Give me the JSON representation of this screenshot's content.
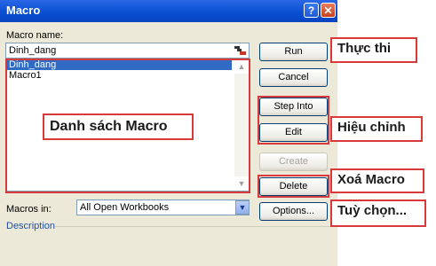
{
  "dialog": {
    "title": "Macro",
    "help_glyph": "?",
    "close_glyph": "✕",
    "macro_name_label": "Macro name:",
    "macro_name_value": "Dinh_dang",
    "macros": [
      "Dinh_dang",
      "Macro1"
    ],
    "selected_index": 0,
    "macros_in_label": "Macros in:",
    "macros_in_value": "All Open Workbooks",
    "description_label": "Description",
    "buttons": {
      "run": "Run",
      "cancel": "Cancel",
      "step_into": "Step Into",
      "edit": "Edit",
      "create": "Create",
      "delete": "Delete",
      "options": "Options..."
    }
  },
  "annotations": {
    "list": "Danh sách Macro",
    "run": "Thực thi",
    "edit": "Hiệu chỉnh",
    "delete": "Xoá Macro",
    "options": "Tuỳ chọn..."
  },
  "icons": {
    "ref_edit": "ref-edit-icon",
    "scroll_up": "scroll-up-arrow-icon",
    "scroll_down": "scroll-down-arrow-icon",
    "dropdown": "chevron-down-icon"
  },
  "colors": {
    "title_bar": "#0a4fd2",
    "dialog_bg": "#ece9d8",
    "selection": "#316ac5",
    "annotation": "#d83a3a"
  }
}
